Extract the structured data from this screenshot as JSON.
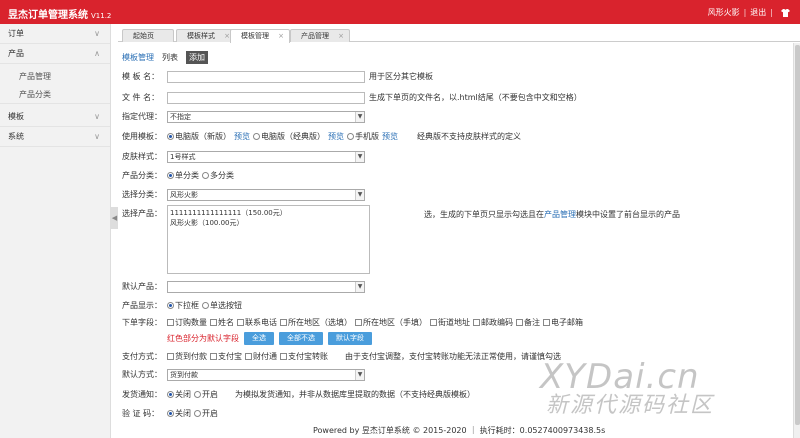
{
  "header": {
    "title": "昱杰订单管理系统",
    "version": "V11.2",
    "user": "风形火影",
    "sep": "|",
    "logout": "退出",
    "sep2": "|"
  },
  "sidebar": {
    "menus": [
      {
        "label": "订单",
        "chev": "∨"
      },
      {
        "label": "产品",
        "chev": "∧"
      },
      {
        "label": "模板",
        "chev": "∨"
      },
      {
        "label": "系统",
        "chev": "∨"
      }
    ],
    "product_subitems": [
      "产品管理",
      "产品分类"
    ],
    "collapse": "◀"
  },
  "tabs": [
    {
      "label": "起始页"
    },
    {
      "label": "模板样式",
      "close": "×"
    },
    {
      "label": "模板管理",
      "close": "×"
    },
    {
      "label": "产品管理",
      "close": "×"
    }
  ],
  "subtabs": {
    "manage": "模板管理",
    "list": "列表",
    "add": "添加"
  },
  "form": {
    "name_label": "模 板 名：",
    "name_hint": "用于区分其它模板",
    "file_label": "文 件 名：",
    "file_hint": "生成下单页的文件名，以.html结尾（不要包含中文和空格）",
    "agent_label": "指定代理：",
    "agent_value": "不指定",
    "tpl_label": "使用模板：",
    "tpl_opts": [
      "电脑版（新版）",
      "电脑版（经典版）",
      "手机版"
    ],
    "preview": "预览",
    "tpl_hint": "经典版不支持皮肤样式的定义",
    "skin_label": "皮肤样式：",
    "skin_value": "1号样式",
    "cat_label": "产品分类：",
    "cat_opts": [
      "单分类",
      "多分类"
    ],
    "select_cat_label": "选择分类：",
    "select_cat_value": "风形火影",
    "select_prod_label": "选择产品：",
    "products": [
      "1111111111111111（150.00元）",
      "风形火影（100.00元）"
    ],
    "prod_hint_a": "选，生成的下单页只显示勾选且在",
    "prod_hint_link": "产品管理",
    "prod_hint_b": "模块中设置了前台显示的产品",
    "default_prod_label": "默认产品：",
    "display_label": "产品显示：",
    "display_opts": [
      "下拉框",
      "单选按钮"
    ],
    "fields_label": "下单字段：",
    "fields": [
      "订购数量",
      "姓名",
      "联系电话",
      "所在地区（选填）",
      "所在地区（手填）",
      "街道地址",
      "邮政编码",
      "备注",
      "电子邮箱"
    ],
    "fields_hint": "红色部分为默认字段",
    "btn_all": "全选",
    "btn_none": "全部不选",
    "btn_default": "默认字段",
    "pay_label": "支付方式：",
    "pay_opts": [
      "货到付款",
      "支付宝",
      "财付通",
      "支付宝转账"
    ],
    "pay_hint": "由于支付宝调整，支付宝转账功能无法正常使用，请谨慎勾选",
    "default_pay_label": "默认方式：",
    "default_pay_value": "货到付款",
    "notify_label": "发货通知：",
    "notify_opts": [
      "关闭",
      "开启"
    ],
    "notify_hint": "为模拟发货通知，并非从数据库里提取的数据（不支持经典版模板）",
    "verify_label": "验 证 码：",
    "verify_opts": [
      "关闭",
      "开启"
    ]
  },
  "footer": {
    "text": "Powered by 昱杰订单系统 © 2015-2020 ｜ 执行耗时：0.0527400973438.5s"
  },
  "watermark": {
    "line1": "XYDai.cn",
    "line2": "新源代源码社区"
  },
  "colors": {
    "brand": "#d9232d",
    "button": "#4a9ddc",
    "link": "#2a6fb5"
  }
}
